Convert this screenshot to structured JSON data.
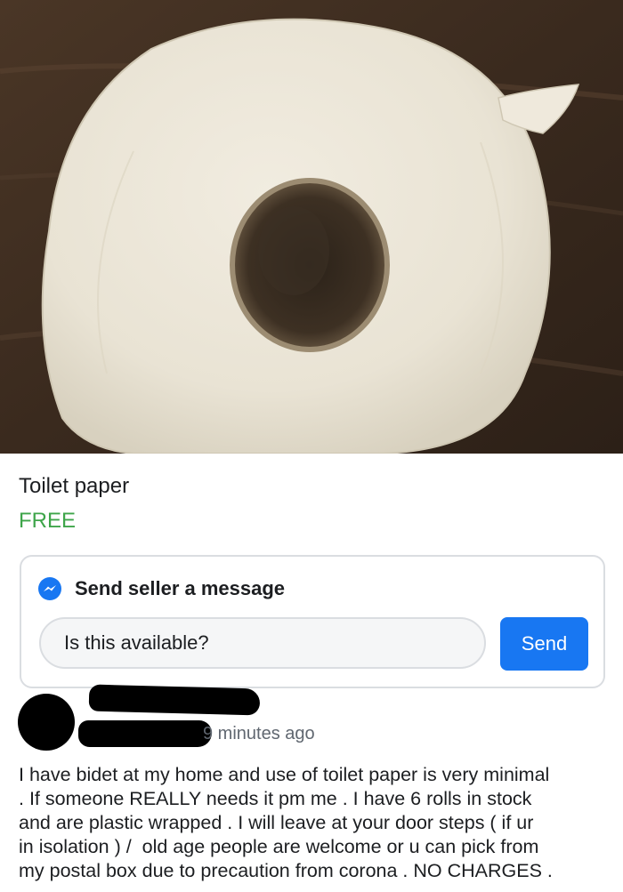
{
  "listing": {
    "title": "Toilet paper",
    "price": "FREE",
    "photo_subject": "roll-of-toilet-paper"
  },
  "message": {
    "heading": "Send seller a message",
    "input_value": "Is this available?",
    "send_label": "Send",
    "icon": "messenger-icon"
  },
  "seller": {
    "posted": "9 minutes ago",
    "name_redacted": true,
    "avatar_redacted": true
  },
  "description": "I have bidet at my home and use of toilet paper is very minimal\n. If someone REALLY needs it pm me . I have 6 rolls in stock\nand are plastic wrapped . I will leave at your door steps ( if ur\nin isolation ) /  old age people are welcome or u can pick from\nmy postal box due to precaution from corona . NO CHARGES .",
  "colors": {
    "price": "#3ea54a",
    "send_button": "#1877f2",
    "messenger_icon": "#1877f2",
    "card_border": "#dadde1",
    "muted_text": "#606770"
  }
}
